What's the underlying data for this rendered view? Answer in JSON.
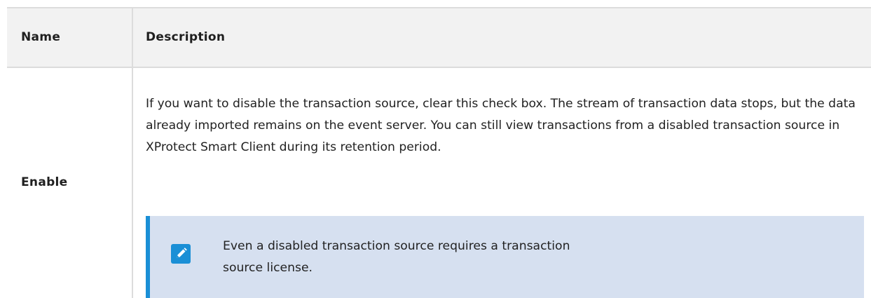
{
  "table": {
    "headers": {
      "name": "Name",
      "description": "Description"
    },
    "rows": [
      {
        "name": "Enable",
        "description": "If you want to disable the transaction source, clear this check box. The stream of transaction data stops, but the data already imported remains on the event server. You can still view transactions from a disabled transaction source in XProtect Smart Client during its retention period.",
        "note": {
          "icon": "pencil-icon",
          "text": "Even a disabled transaction source requires a transaction source license."
        }
      }
    ]
  },
  "colors": {
    "header_bg": "#f2f2f2",
    "border": "#dcdcdc",
    "note_bg": "#d6e0f0",
    "note_accent": "#1a8fd6"
  }
}
